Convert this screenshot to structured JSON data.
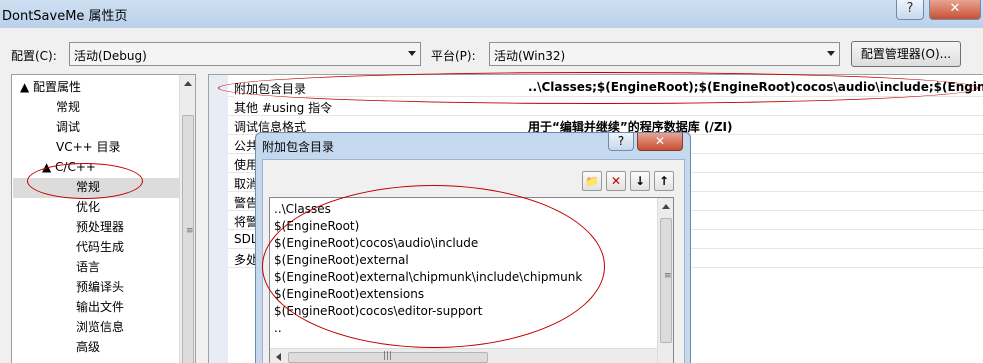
{
  "window": {
    "title": "DontSaveMe 属性页",
    "help_label": "?",
    "close_label": "✕"
  },
  "toolbar": {
    "config_label": "配置(C):",
    "config_value": "活动(Debug)",
    "platform_label": "平台(P):",
    "platform_value": "活动(Win32)",
    "config_manager_label": "配置管理器(O)..."
  },
  "tree": {
    "items": [
      {
        "label": "▲ 配置属性"
      },
      {
        "label": "常规"
      },
      {
        "label": "调试"
      },
      {
        "label": "VC++ 目录"
      },
      {
        "label": "▲ C/C++"
      },
      {
        "label": "常规"
      },
      {
        "label": "优化"
      },
      {
        "label": "预处理器"
      },
      {
        "label": "代码生成"
      },
      {
        "label": "语言"
      },
      {
        "label": "预编译头"
      },
      {
        "label": "输出文件"
      },
      {
        "label": "浏览信息"
      },
      {
        "label": "高级"
      }
    ]
  },
  "grid": {
    "rows": [
      {
        "name": "附加包含目录",
        "value": "..\\Classes;$(EngineRoot);$(EngineRoot)cocos\\audio\\include;$(EngineRo"
      },
      {
        "name": "其他 #using 指令",
        "value": ""
      },
      {
        "name": "调试信息格式",
        "value": "用于“编辑并继续”的程序数据库 (/ZI)"
      },
      {
        "name": "公共",
        "value": ""
      },
      {
        "name": "使用",
        "value": ""
      },
      {
        "name": "取消",
        "value": ""
      },
      {
        "name": "警告",
        "value": ""
      },
      {
        "name": "将警",
        "value": ""
      },
      {
        "name": "SDL",
        "value": ""
      },
      {
        "name": "多处",
        "value": ""
      }
    ]
  },
  "dialog": {
    "title": "附加包含目录",
    "help_label": "?",
    "close_label": "✕",
    "lines": [
      "..\\Classes",
      "$(EngineRoot)",
      "$(EngineRoot)cocos\\audio\\include",
      "$(EngineRoot)external",
      "$(EngineRoot)external\\chipmunk\\include\\chipmunk",
      "$(EngineRoot)extensions",
      "$(EngineRoot)cocos\\editor-support",
      ".."
    ],
    "tools": {
      "new_folder": "📁",
      "delete": "✕",
      "move_down": "↓",
      "move_up": "↑"
    }
  }
}
